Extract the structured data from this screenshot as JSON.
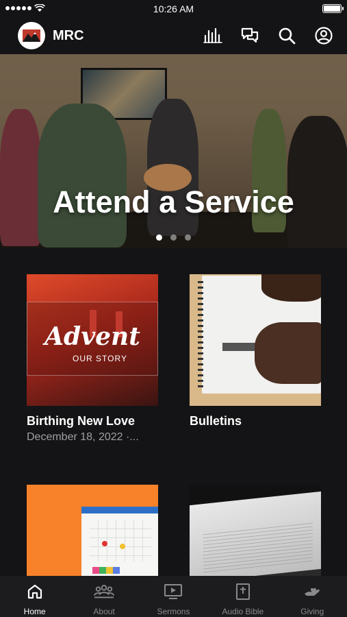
{
  "status_bar": {
    "time": "10:26 AM"
  },
  "app_bar": {
    "name": "MRC"
  },
  "hero": {
    "title": "Attend a Service",
    "page_count": 3,
    "active_page": 1
  },
  "cards": [
    {
      "title": "Birthing New Love",
      "subtitle": "December 18, 2022 ·...",
      "art_title": "Advent",
      "art_sub": "OUR STORY"
    },
    {
      "title": "Bulletins",
      "subtitle": ""
    },
    {
      "title": "",
      "subtitle": ""
    },
    {
      "title": "",
      "subtitle": ""
    }
  ],
  "tabs": [
    {
      "label": "Home",
      "icon": "home-icon",
      "active": true
    },
    {
      "label": "About",
      "icon": "people-icon",
      "active": false
    },
    {
      "label": "Sermons",
      "icon": "video-icon",
      "active": false
    },
    {
      "label": "Audio Bible",
      "icon": "bible-icon",
      "active": false
    },
    {
      "label": "Giving",
      "icon": "giving-icon",
      "active": false
    }
  ],
  "colors": {
    "background": "#141416",
    "tab_bar": "#1c1c1e",
    "accent": "#ffffff"
  }
}
